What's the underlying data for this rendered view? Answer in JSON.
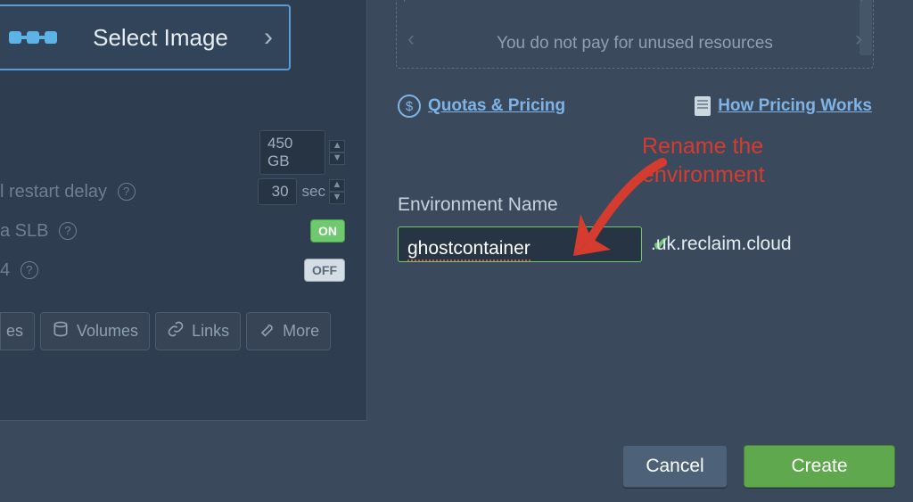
{
  "left": {
    "select_image_label": "Select Image",
    "settings": {
      "row0": {
        "label_fragment": "",
        "value_text": "450 GB"
      },
      "row1": {
        "label_fragment": "l restart delay",
        "value_num": "30",
        "value_unit": "sec"
      },
      "row2": {
        "label_fragment": "a SLB",
        "chip": "ON"
      },
      "row3": {
        "label_fragment": "4",
        "chip": "OFF"
      }
    },
    "tabs": {
      "first_cut_suffix": "es",
      "volumes": "Volumes",
      "links": "Links",
      "more": "More"
    }
  },
  "right": {
    "unused_msg": "You do not pay for unused resources",
    "quotas_link": "Quotas & Pricing",
    "how_pricing_link": "How Pricing Works",
    "env_label": "Environment Name",
    "env_input_value": "ghostcontainer",
    "domain_suffix": ".uk.reclaim.cloud"
  },
  "annotation": {
    "line1": "Rename the",
    "line2": "environment"
  },
  "footer": {
    "cancel": "Cancel",
    "create": "Create"
  },
  "icons": {
    "nodes": "nodes-chain",
    "chevron_right": "chevron-right",
    "help": "help-circle",
    "dollar": "dollar-circle",
    "document": "document",
    "check": "check",
    "volumes": "disk",
    "links": "link",
    "more": "wrench",
    "carousel_left": "chevron-left",
    "carousel_right": "chevron-right"
  }
}
